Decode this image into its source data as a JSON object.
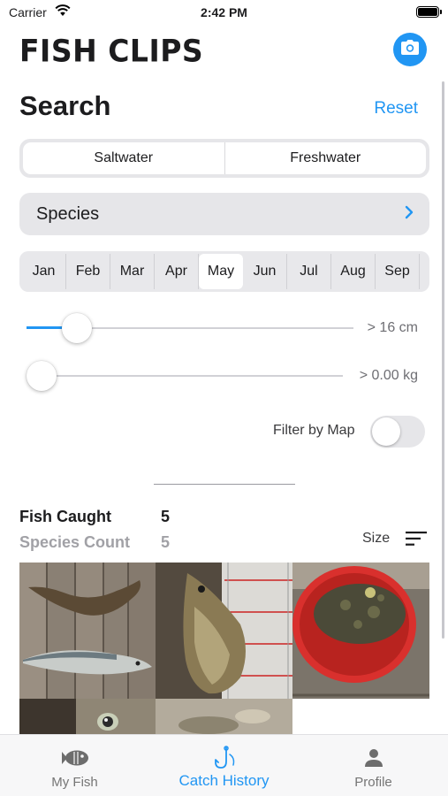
{
  "status_bar": {
    "carrier": "Carrier",
    "time": "2:42 PM",
    "battery_percent": 100
  },
  "header": {
    "app_title": "FISH CLIPS",
    "camera_icon": "camera-icon"
  },
  "search": {
    "title": "Search",
    "reset_label": "Reset",
    "water_types": [
      "Saltwater",
      "Freshwater"
    ],
    "species_label": "Species",
    "months": [
      "Jan",
      "Feb",
      "Mar",
      "Apr",
      "May",
      "Jun",
      "Jul",
      "Aug",
      "Sep"
    ],
    "selected_month": "May",
    "length_filter": {
      "value": "> 16 cm",
      "fill_fraction": 0.12
    },
    "weight_filter": {
      "value": "> 0.00 kg",
      "fill_fraction": 0.0
    },
    "map_filter": {
      "label": "Filter by Map",
      "enabled": false
    }
  },
  "results": {
    "fish_caught_label": "Fish Caught",
    "fish_caught_value": "5",
    "species_count_label": "Species Count",
    "species_count_value": "5",
    "sort_label": "Size",
    "sort_icon": "sort-lines-icon"
  },
  "tab_bar": {
    "tabs": [
      {
        "label": "My Fish",
        "icon": "fish-icon"
      },
      {
        "label": "Catch History",
        "icon": "fishhook-icon"
      },
      {
        "label": "Profile",
        "icon": "person-icon"
      }
    ],
    "active_tab": "Catch History"
  },
  "colors": {
    "accent": "#2196f3",
    "control_background": "#e6e6e9",
    "muted_text": "#a1a1a6"
  }
}
